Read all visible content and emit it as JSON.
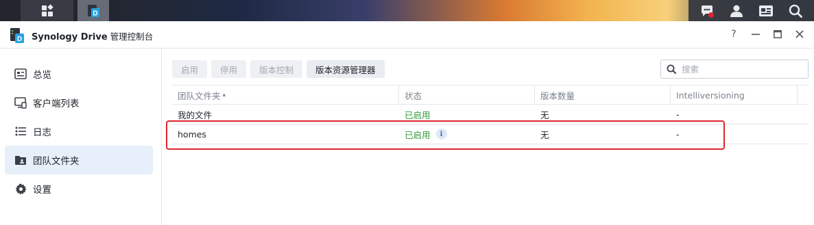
{
  "taskbar": {
    "icons": [
      "main-menu-icon",
      "synology-drive-icon",
      "chat-icon",
      "user-icon",
      "widgets-icon",
      "search-icon"
    ],
    "notification_color": "#e0242b"
  },
  "window": {
    "title": "Synology Drive",
    "subtitle": "管理控制台",
    "controls": {
      "help": "?",
      "minimize": "—",
      "maximize": "☐",
      "close": "✕"
    }
  },
  "sidebar": {
    "items": [
      {
        "label": "总览",
        "icon": "overview-icon",
        "active": false
      },
      {
        "label": "客户端列表",
        "icon": "client-list-icon",
        "active": false
      },
      {
        "label": "日志",
        "icon": "log-icon",
        "active": false
      },
      {
        "label": "团队文件夹",
        "icon": "team-folder-icon",
        "active": true
      },
      {
        "label": "设置",
        "icon": "gear-icon",
        "active": false
      }
    ]
  },
  "toolbar": {
    "enable": "启用",
    "disable": "停用",
    "version_control": "版本控制",
    "version_explorer": "版本资源管理器"
  },
  "search": {
    "placeholder": "搜索"
  },
  "table": {
    "headers": [
      "团队文件夹",
      "状态",
      "版本数量",
      "Intelliversioning"
    ],
    "sort_indicator": "▴",
    "rows": [
      {
        "folder": "我的文件",
        "status": "已启用",
        "versions": "无",
        "intelliversioning": "-"
      },
      {
        "folder": "homes",
        "status": "已启用",
        "versions": "无",
        "intelliversioning": "-",
        "info": "i"
      }
    ]
  },
  "colors": {
    "accent": "#2e9a37",
    "highlight": "#e0242b",
    "active_bg": "#e6effa"
  }
}
